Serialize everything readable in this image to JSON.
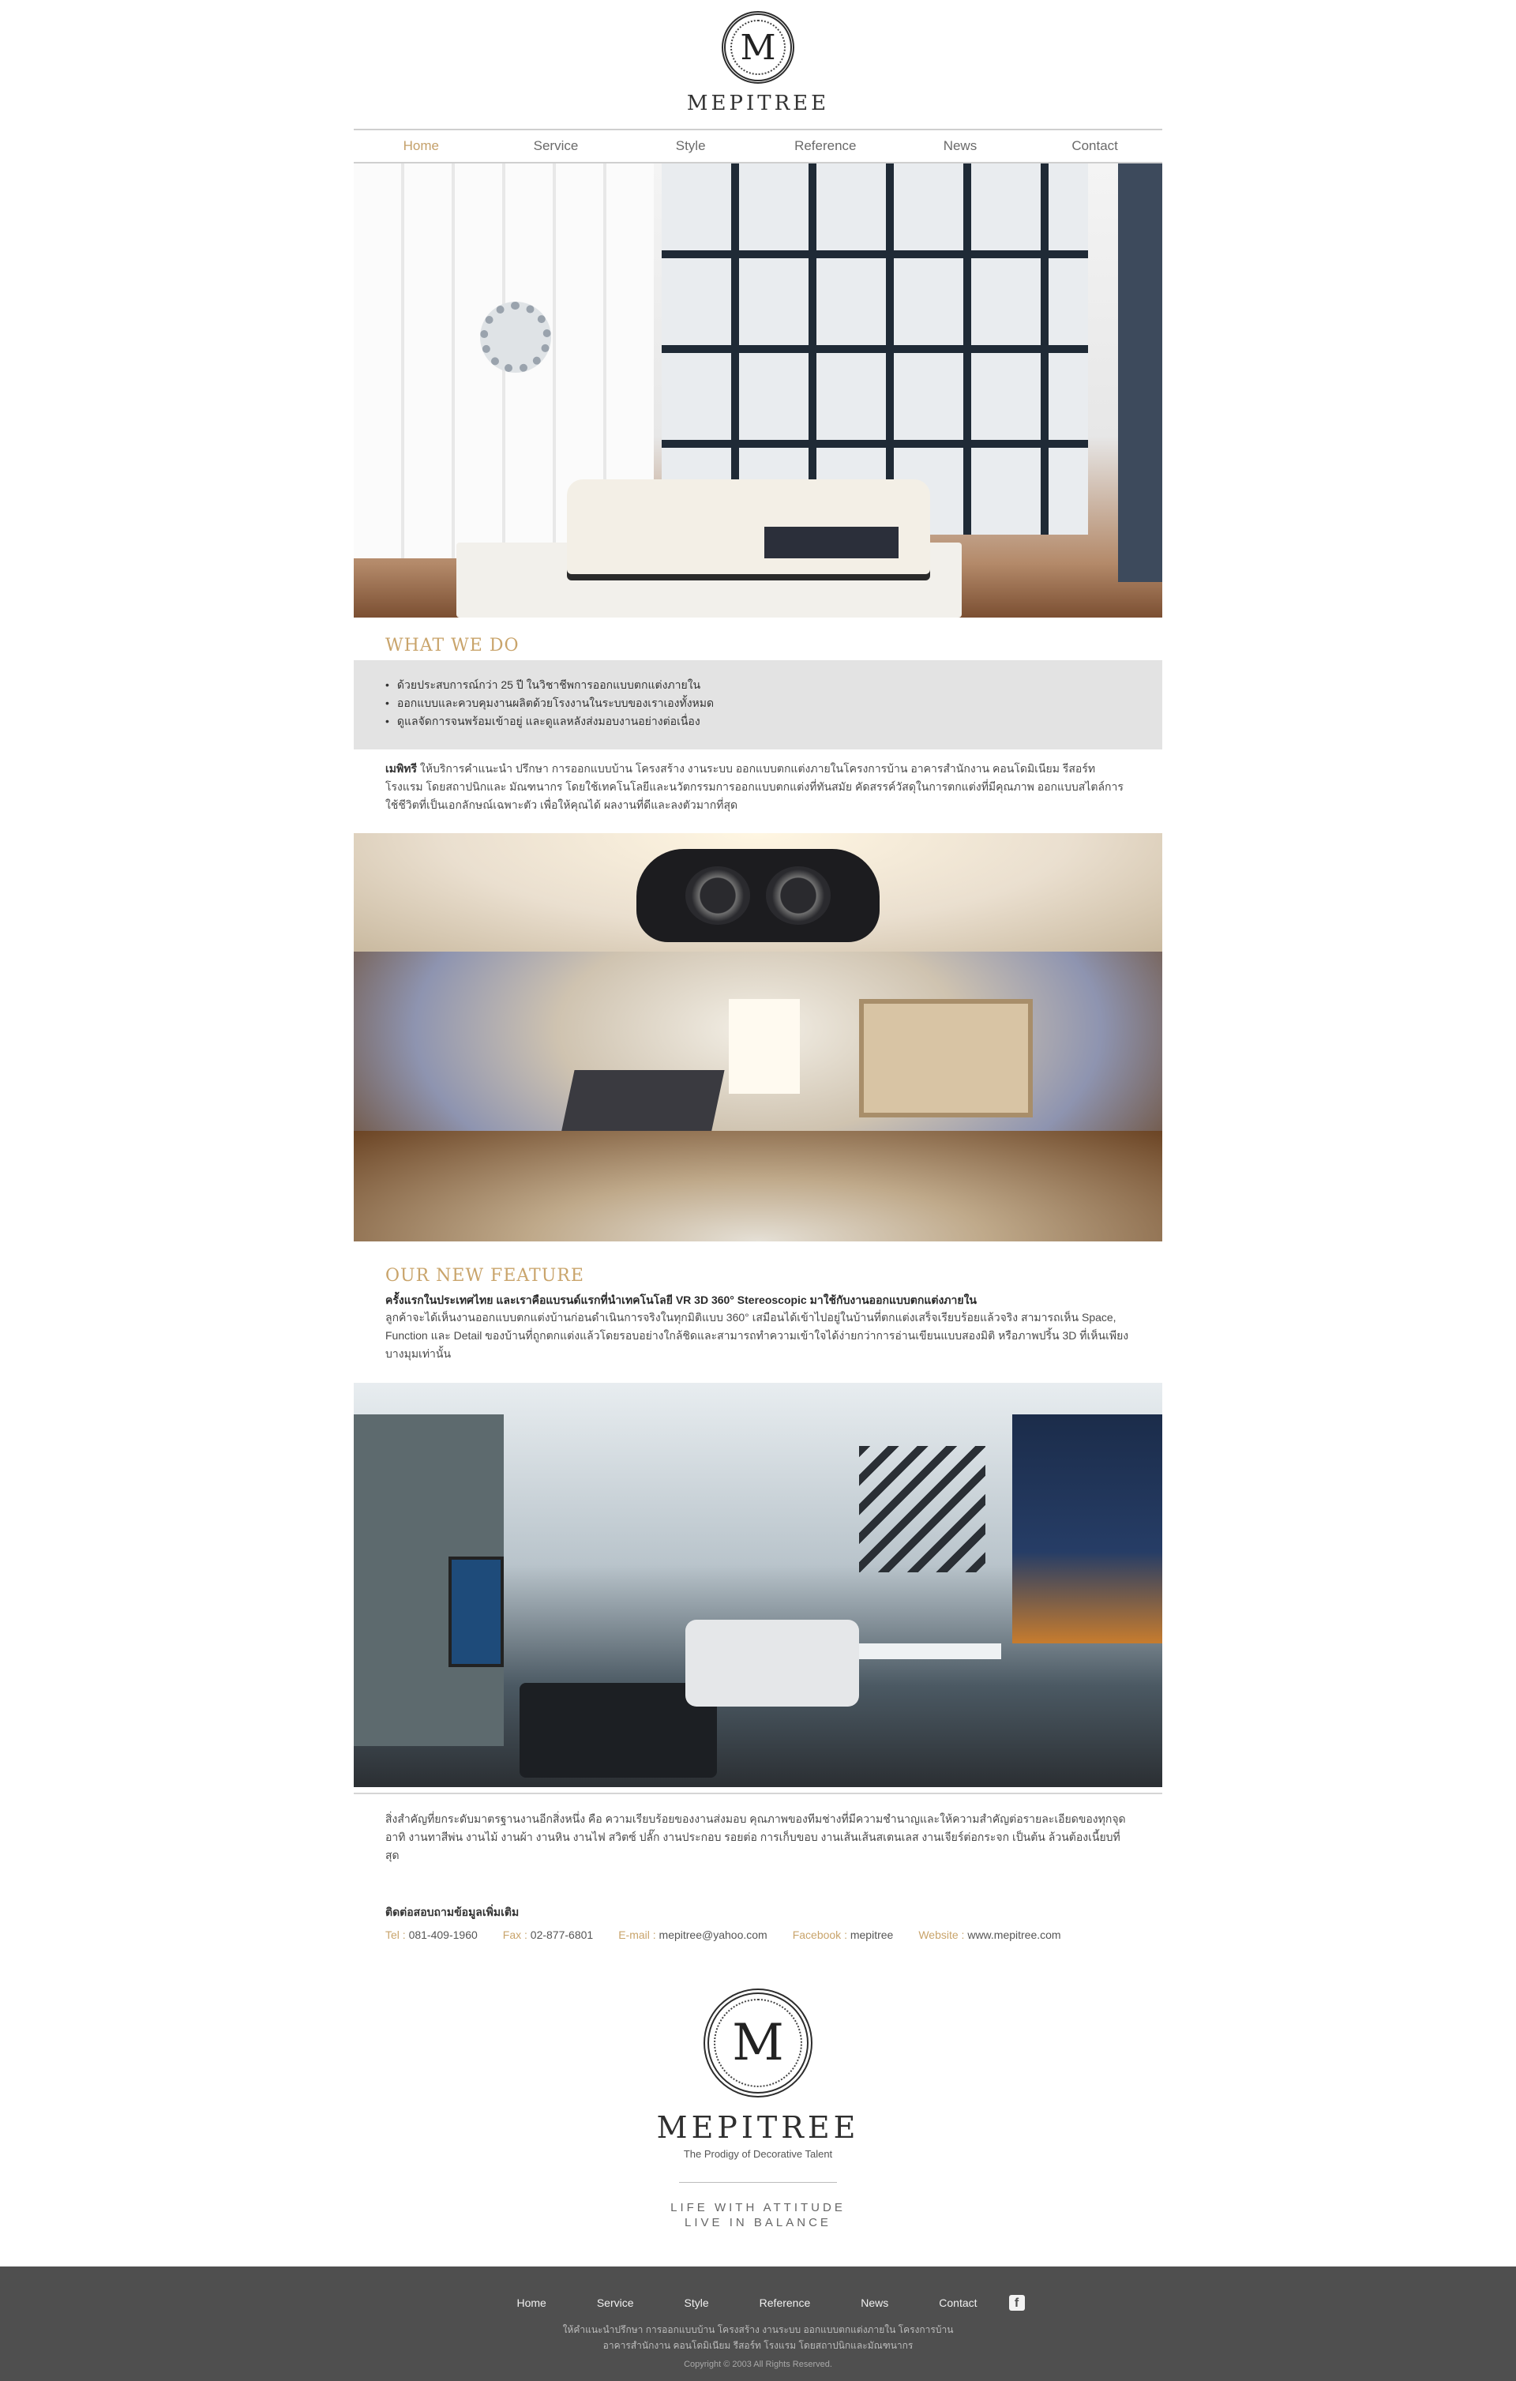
{
  "brand": {
    "name": "MEPITREE",
    "logo_letter": "M",
    "tagline": "The Prodigy of Decorative Talent",
    "motto_line1": "LIFE WITH ATTITUDE",
    "motto_line2": "LIVE IN BALANCE"
  },
  "nav": {
    "items": [
      "Home",
      "Service",
      "Style",
      "Reference",
      "News",
      "Contact"
    ],
    "active": "Home"
  },
  "what_we_do": {
    "title": "WHAT WE DO",
    "bullets": [
      "ด้วยประสบการณ์กว่า 25 ปี ในวิชาชีพการออกแบบตกแต่งภายใน",
      "ออกแบบและควบคุมงานผลิตด้วยโรงงานในระบบของเราเองทั้งหมด",
      "ดูแลจัดการจนพร้อมเข้าอยู่ และดูแลหลังส่งมอบงานอย่างต่อเนื่อง"
    ],
    "intro_bold": "เมพิทรี",
    "intro_text": " ให้บริการคำแนะนำ ปรึกษา การออกแบบบ้าน โครงสร้าง งานระบบ ออกแบบตกแต่งภายในโครงการบ้าน อาคารสำนักงาน คอนโดมิเนียม รีสอร์ท โรงแรม โดยสถาปนิกและ มัณฑนากร โดยใช้เทคโนโลยีและนวัตกรรมการออกแบบตกแต่งที่ทันสมัย คัดสรรค์วัสดุในการตกแต่งที่มีคุณภาพ ออกแบบสไตล์การใช้ชีวิตที่เป็นเอกลักษณ์เฉพาะตัว เพื่อให้คุณได้ ผลงานที่ดีและลงตัวมากที่สุด"
  },
  "new_feature": {
    "title": "OUR NEW FEATURE",
    "headline": "ครั้งแรกในประเทศไทย และเราคือแบรนด์แรกที่นำเทคโนโลยี VR 3D 360° Stereoscopic มาใช้กับงานออกแบบตกแต่งภายใน",
    "body": "ลูกค้าจะได้เห็นงานออกแบบตกแต่งบ้านก่อนดำเนินการจริงในทุกมิติแบบ 360° เสมือนได้เข้าไปอยู่ในบ้านที่ตกแต่งเสร็จเรียบร้อยแล้วจริง สามารถเห็น Space, Function และ Detail ของบ้านที่ถูกตกแต่งแล้วโดยรอบอย่างใกล้ชิดและสามารถทำความเข้าใจได้ง่ายกว่าการอ่านเขียนแบบสองมิติ หรือภาพปริ้น 3D ที่เห็นเพียงบางมุมเท่านั้น"
  },
  "closing": {
    "text": "สิ่งสำคัญที่ยกระดับมาตรฐานงานอีกสิ่งหนึ่ง คือ ความเรียบร้อยของงานส่งมอบ คุณภาพของทีมช่างที่มีความชำนาญและให้ความสำคัญต่อรายละเอียดของทุกจุด อาทิ งานทาสีพ่น งานไม้ งานผ้า งานหิน งานไฟ สวิตซ์ ปลั๊ก งานประกอบ รอยต่อ การเก็บขอบ งานเส้นเส้นสเตนเลส งานเจียร์ต่อกระจก เป็นต้น ล้วนต้องเนี้ยบที่สุด"
  },
  "contact": {
    "heading": "ติดต่อสอบถามข้อมูลเพิ่มเติม",
    "items": [
      {
        "label": "Tel :",
        "value": "081-409-1960"
      },
      {
        "label": "Fax :",
        "value": "02-877-6801"
      },
      {
        "label": "E-mail :",
        "value": "mepitree@yahoo.com"
      },
      {
        "label": "Facebook :",
        "value": "mepitree"
      },
      {
        "label": "Website :",
        "value": "www.mepitree.com"
      }
    ]
  },
  "footer": {
    "nav": [
      "Home",
      "Service",
      "Style",
      "Reference",
      "News",
      "Contact"
    ],
    "facebook_icon": "f",
    "address_line1": "ให้คำแนะนำปรึกษา การออกแบบบ้าน โครงสร้าง งานระบบ ออกแบบตกแต่งภายใน โครงการบ้าน",
    "address_line2": "อาคารสำนักงาน คอนโดมิเนียม รีสอร์ท โรงแรม โดยสถาปนิกและมัณฑนากร",
    "copyright": "Copyright © 2003 All Rights Reserved."
  },
  "colors": {
    "accent_gold": "#c9a46b",
    "footer_bg": "#4f4f4f",
    "grey_box": "#e3e3e3"
  },
  "images": {
    "hero1": "luxury-living-room-render",
    "hero2": "vr-360-bedroom-panorama",
    "hero3": "modern-condo-living-room-night"
  }
}
